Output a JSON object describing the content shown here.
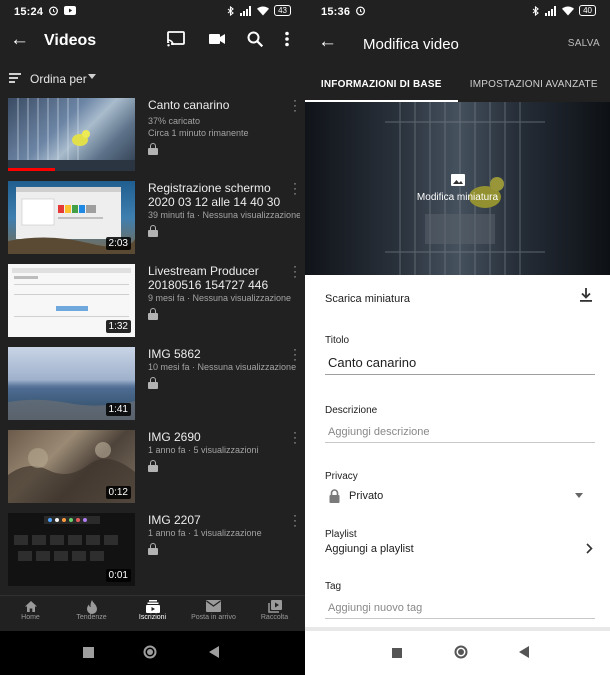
{
  "left": {
    "status": {
      "time": "15:24",
      "battery": "43"
    },
    "appbar": {
      "title": "Videos",
      "icons": [
        "back-arrow-icon",
        "cast-icon",
        "video-camera-icon",
        "search-icon",
        "more-vert-icon"
      ]
    },
    "sort": {
      "label": "Ordina per"
    },
    "videos": [
      {
        "title": "Canto canarino",
        "meta1": "37% caricato",
        "meta2": "Circa 1 minuto rimanente",
        "duration": "",
        "progress": 0.37
      },
      {
        "title": "Registrazione schermo 2020 03 12 alle 14 40 30",
        "meta1": "39 minuti fa · Nessuna visualizzazione",
        "meta2": "",
        "duration": "2:03"
      },
      {
        "title": "Livestream Producer 20180516 154727 446",
        "meta1": "9 mesi fa · Nessuna visualizzazione",
        "meta2": "",
        "duration": "1:32"
      },
      {
        "title": "IMG 5862",
        "meta1": "10 mesi fa · Nessuna visualizzazione",
        "meta2": "",
        "duration": "1:41"
      },
      {
        "title": "IMG 2690",
        "meta1": "1 anno fa · 5 visualizzazioni",
        "meta2": "",
        "duration": "0:12"
      },
      {
        "title": "IMG 2207",
        "meta1": "1 anno fa · 1 visualizzazione",
        "meta2": "",
        "duration": "0:01"
      }
    ],
    "bottom_nav": [
      {
        "label": "Home",
        "icon": "home-icon",
        "active": false
      },
      {
        "label": "Tendenze",
        "icon": "flame-icon",
        "active": false
      },
      {
        "label": "Iscrizioni",
        "icon": "subscriptions-icon",
        "active": true
      },
      {
        "label": "Posta in arrivo",
        "icon": "mail-icon",
        "active": false
      },
      {
        "label": "Raccolta",
        "icon": "library-icon",
        "active": false
      }
    ]
  },
  "right": {
    "status": {
      "time": "15:36",
      "battery": "40"
    },
    "appbar": {
      "title": "Modifica video",
      "save_label": "SALVA"
    },
    "tabs": [
      {
        "label": "INFORMAZIONI DI BASE",
        "active": true
      },
      {
        "label": "IMPOSTAZIONI AVANZATE",
        "active": false
      }
    ],
    "hero": {
      "edit_label": "Modifica miniatura"
    },
    "download": {
      "label": "Scarica miniatura"
    },
    "title_field": {
      "label": "Titolo",
      "value": "Canto canarino"
    },
    "description_field": {
      "label": "Descrizione",
      "placeholder": "Aggiungi descrizione"
    },
    "privacy": {
      "label": "Privacy",
      "value": "Privato"
    },
    "playlist": {
      "label": "Playlist",
      "value": "Aggiungi a playlist"
    },
    "tags": {
      "label": "Tag",
      "placeholder": "Aggiungi nuovo tag"
    }
  },
  "colors": {
    "dark_bg": "#212121",
    "light_bg": "#ffffff",
    "meta_text": "#a3a3a3"
  }
}
